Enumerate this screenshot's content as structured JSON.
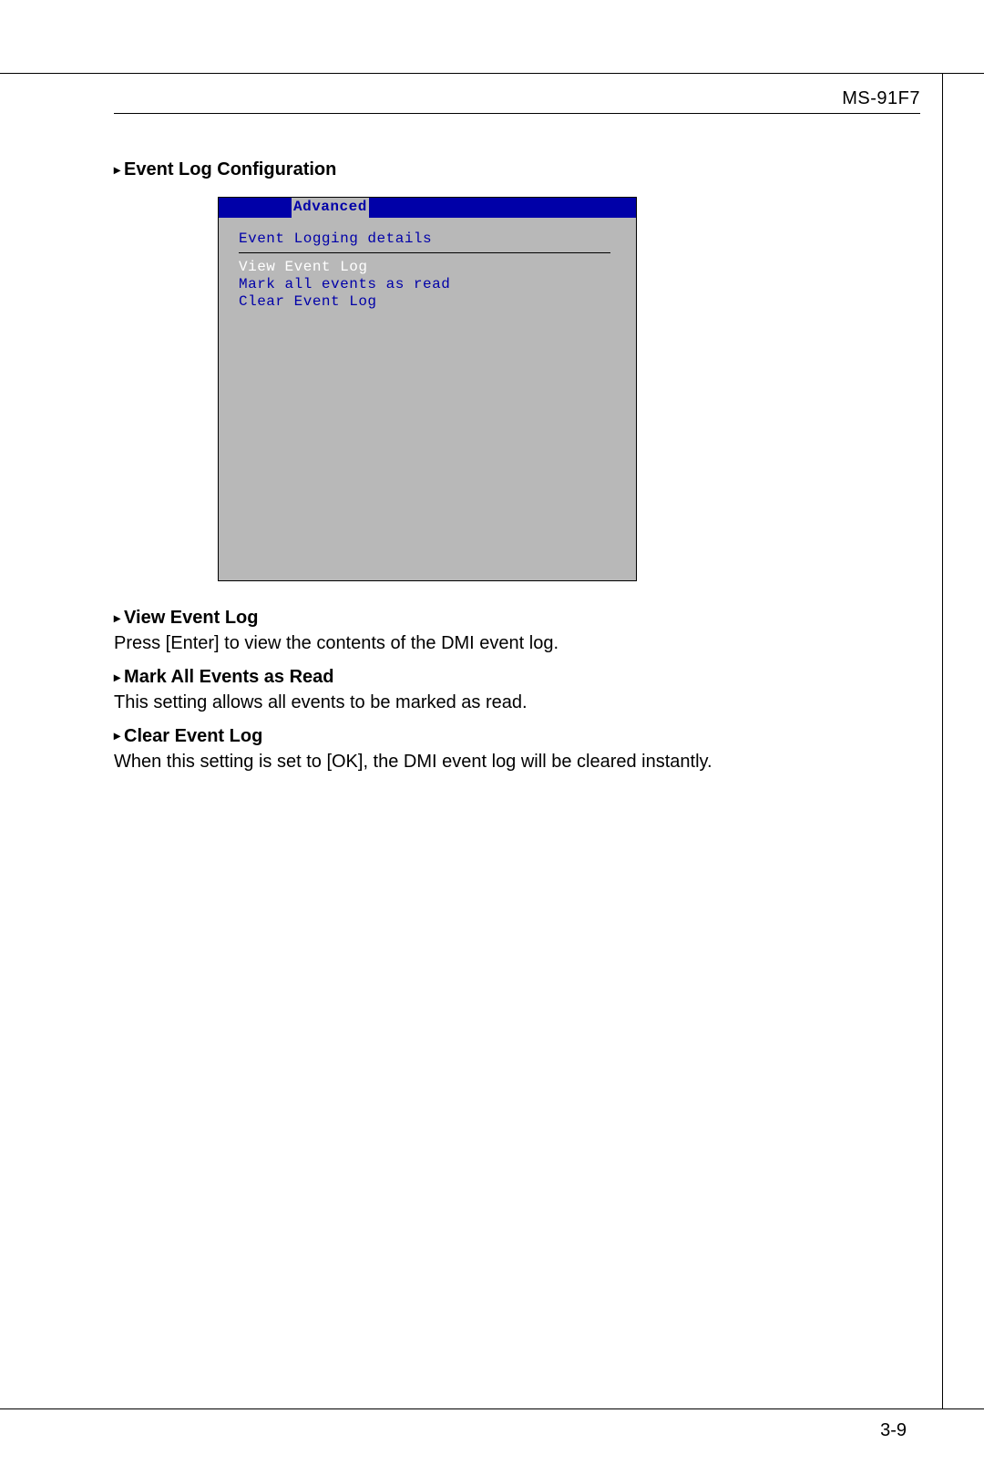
{
  "header": {
    "model": "MS-91F7"
  },
  "section": {
    "title": "Event Log Configuration"
  },
  "bios": {
    "tab": "Advanced",
    "panel_title": "Event Logging details",
    "items": [
      {
        "label": "View Event Log",
        "selected": true
      },
      {
        "label": "Mark all events as read",
        "selected": false
      },
      {
        "label": "Clear Event Log",
        "selected": false
      }
    ]
  },
  "descriptions": [
    {
      "heading": "View Event Log",
      "body": "Press [Enter] to view the contents of the DMI event log."
    },
    {
      "heading": "Mark All Events as Read",
      "body": "This setting allows all events to be marked as read."
    },
    {
      "heading": "Clear Event Log",
      "body": "When this setting is set to [OK], the DMI event log will be cleared instantly."
    }
  ],
  "footer": {
    "page": "3-9"
  }
}
